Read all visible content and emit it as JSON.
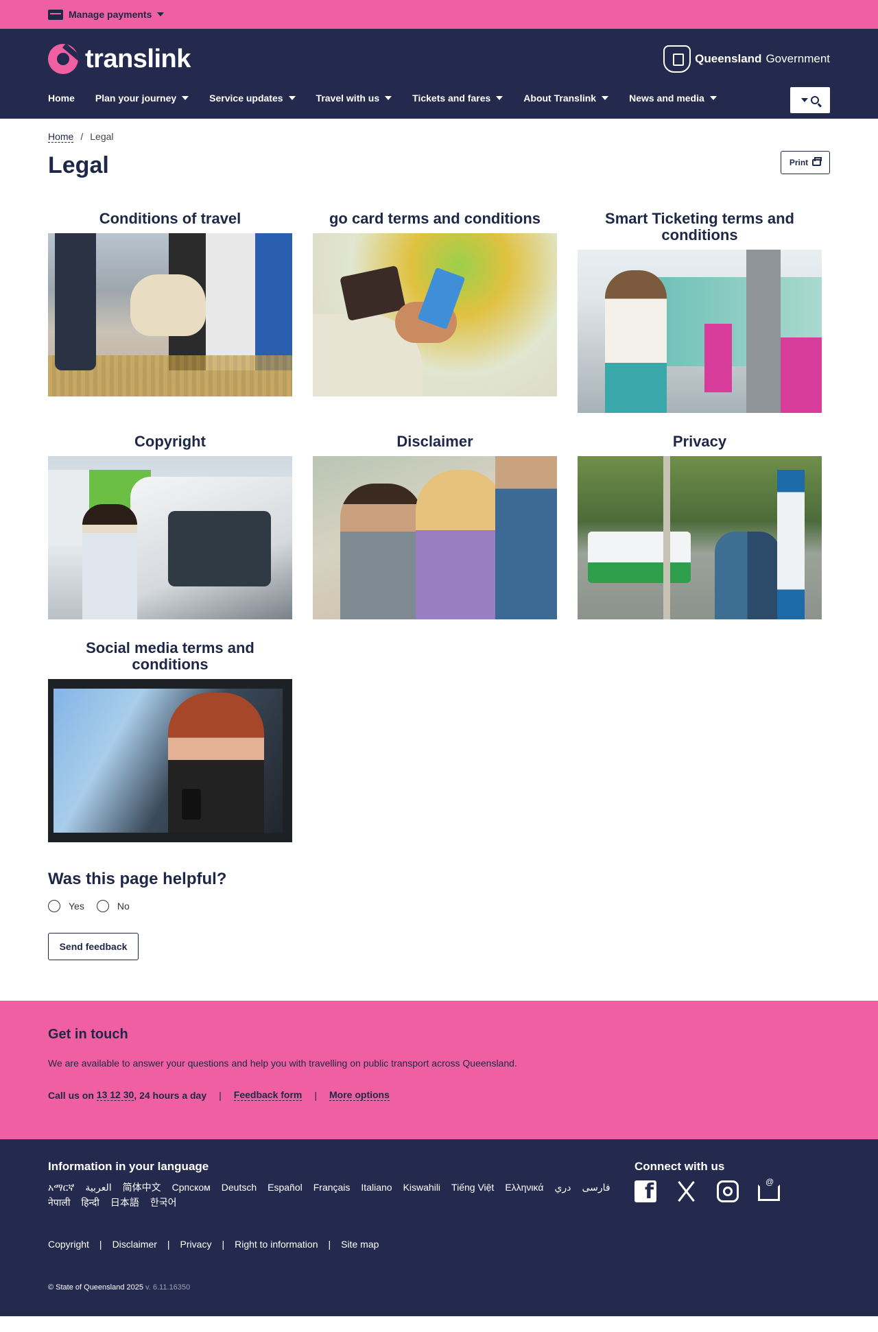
{
  "utility": {
    "manage_payments": "Manage payments"
  },
  "header": {
    "logo_text": "translink",
    "gov_bold": "Queensland",
    "gov_rest": "Government",
    "nav": [
      "Home",
      "Plan your journey",
      "Service updates",
      "Travel with us",
      "Tickets and fares",
      "About Translink",
      "News and media"
    ]
  },
  "breadcrumb": {
    "home": "Home",
    "sep": "/",
    "current": "Legal"
  },
  "page": {
    "title": "Legal",
    "print_label": "Print"
  },
  "tiles": [
    {
      "title": "Conditions of travel"
    },
    {
      "title": "go card terms and conditions"
    },
    {
      "title": "Smart Ticketing terms and conditions"
    },
    {
      "title": "Copyright"
    },
    {
      "title": "Disclaimer"
    },
    {
      "title": "Privacy"
    },
    {
      "title": "Social media terms and conditions"
    }
  ],
  "feedback": {
    "heading": "Was this page helpful?",
    "yes": "Yes",
    "no": "No",
    "send": "Send feedback"
  },
  "touch": {
    "heading": "Get in touch",
    "text": "We are available to answer your questions and help you with travelling on public transport across Queensland.",
    "call_prefix": "Call us on",
    "phone": "13 12 30",
    "call_suffix": ", 24 hours a day",
    "sep": "|",
    "feedback_form": "Feedback form",
    "more_options": "More options"
  },
  "footer": {
    "lang_heading": "Information in your language",
    "languages": [
      "አማርኛ",
      "العربية",
      "简体中文",
      "Српском",
      "Deutsch",
      "Español",
      "Français",
      "Italiano",
      "Kiswahili",
      "Tiếng Việt",
      "Ελληνικά",
      "دري",
      "فارسی",
      "नेपाली",
      "हिन्दी",
      "日本語",
      "한국어"
    ],
    "connect_heading": "Connect with us",
    "links": [
      "Copyright",
      "Disclaimer",
      "Privacy",
      "Right to information",
      "Site map"
    ],
    "link_sep": "|",
    "copyright": "© State of Queensland 2025",
    "version": "v. 6.11.16350"
  },
  "colors": {
    "pink": "#ef5fa1",
    "navy": "#242a4d",
    "text": "#1f2747"
  }
}
